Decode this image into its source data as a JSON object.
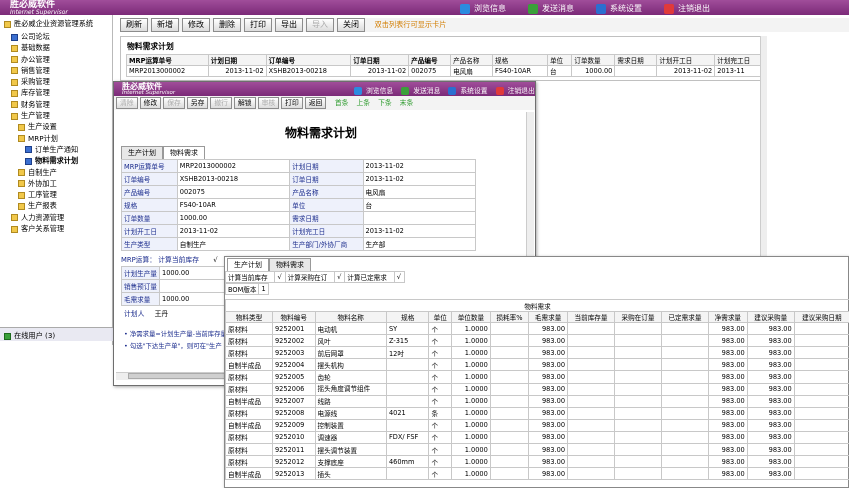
{
  "app": {
    "title": "胜必威企业资源管理系统",
    "logo": "胜必威软件",
    "logo_sub": "Internet Supervisor"
  },
  "topnav": [
    {
      "label": "浏览信息",
      "icon": "browse-icon"
    },
    {
      "label": "发送消息",
      "icon": "send-message-icon"
    },
    {
      "label": "系统设置",
      "icon": "gear-icon"
    },
    {
      "label": "注销退出",
      "icon": "logout-icon"
    }
  ],
  "sidebar": {
    "items": [
      {
        "label": "公司论坛",
        "icon": "forum-icon",
        "indent": 1
      },
      {
        "label": "基础数据",
        "indent": 1
      },
      {
        "label": "办公管理",
        "indent": 1
      },
      {
        "label": "销售管理",
        "indent": 1
      },
      {
        "label": "采购管理",
        "indent": 1
      },
      {
        "label": "库存管理",
        "indent": 1
      },
      {
        "label": "财务管理",
        "indent": 1
      },
      {
        "label": "生产管理",
        "indent": 1
      },
      {
        "label": "生产设置",
        "indent": 2
      },
      {
        "label": "MRP计划",
        "indent": 2
      },
      {
        "label": "订单生产通知",
        "indent": 3,
        "icon": "doc-icon"
      },
      {
        "label": "物料需求计划",
        "indent": 3,
        "icon": "doc-icon",
        "bold": true
      },
      {
        "label": "自制生产",
        "indent": 2
      },
      {
        "label": "外协加工",
        "indent": 2
      },
      {
        "label": "工序管理",
        "indent": 2
      },
      {
        "label": "生产报表",
        "indent": 2
      },
      {
        "label": "人力资源管理",
        "indent": 1
      },
      {
        "label": "客户关系管理",
        "indent": 1
      }
    ],
    "online": "在线用户 (3)"
  },
  "toolbar": {
    "buttons": [
      "刷新",
      "新增",
      "修改",
      "删除",
      "打印",
      "导出",
      "导入",
      "关闭"
    ],
    "disabled": [
      "导入"
    ],
    "hint": "双击列表行可显示卡片"
  },
  "listpanel": {
    "title": "物料需求计划",
    "headers": [
      "MRP运算单号",
      "计划日期",
      "订单编号",
      "订单日期",
      "产品编号",
      "产品名称",
      "规格",
      "单位",
      "订单数量",
      "需求日期",
      "计划开工日",
      "计划完工日"
    ],
    "row": [
      "MRP2013000002",
      "2013-11-02",
      "XSHB2013-00218",
      "2013-11-02",
      "002075",
      "电风扇",
      "FS40-10AR",
      "台",
      "1000.00",
      "",
      "2013-11-02",
      "2013-11"
    ]
  },
  "card": {
    "logo": "胜必威软件",
    "logo_sub": "Internet Supervisor",
    "nav": [
      "浏览信息",
      "发送消息",
      "系统设置",
      "注销退出"
    ],
    "buttons": [
      "清除",
      "修改",
      "保存",
      "另存",
      "撤行",
      "解锁",
      "审核",
      "打印",
      "返回"
    ],
    "disabled": [
      "清除",
      "保存",
      "撤行",
      "审核"
    ],
    "navlinks": [
      "首条",
      "上条",
      "下条",
      "末条"
    ],
    "title": "物料需求计划",
    "tabs": [
      "生产计划",
      "物料需求"
    ],
    "fields": [
      [
        "MRP运算单号",
        "MRP2013000002",
        "计划日期",
        "2013-11-02"
      ],
      [
        "订单编号",
        "XSHB2013-00218",
        "订单日期",
        "2013-11-02"
      ],
      [
        "产品编号",
        "002075",
        "产品名称",
        "电风扇"
      ],
      [
        "规格",
        "FS40-10AR",
        "单位",
        "台"
      ],
      [
        "订单数量",
        "1000.00",
        "需求日期",
        ""
      ],
      [
        "计划开工日",
        "2013-11-02",
        "计划完工日",
        "2013-11-02"
      ],
      [
        "生产类型",
        "自制生产",
        "生产部门/外协厂商",
        "生产部"
      ]
    ],
    "mrp_label": "MRP运算：",
    "mrp_opt": "计算当前库存",
    "mrp_check": "√",
    "small_fields": [
      [
        "计划生产量",
        "1000.00"
      ],
      [
        "销售预订量",
        ""
      ],
      [
        "毛需求量",
        "1000.00"
      ]
    ],
    "planner_label": "计划人",
    "planner": "王丹",
    "notes": [
      "净需求量=计划生产量-当前库存量+销",
      "勾选\"下达生产单\"，则可在\"生产"
    ]
  },
  "detail": {
    "tabs": [
      "生产计划",
      "物料需求"
    ],
    "options": [
      "计算当前库存",
      "√",
      "计算采购在订",
      "√",
      "计算已定需求",
      "√"
    ],
    "bom_label": "BOM版本",
    "bom": "1",
    "section": "物料需求",
    "headers": [
      "物料类型",
      "物料编号",
      "物料名称",
      "规格",
      "单位",
      "单位数量",
      "损耗率%",
      "毛需求量",
      "当前库存量",
      "采购在订量",
      "已定需求量",
      "净需求量",
      "建议采购量",
      "建议采购日期"
    ],
    "rows": [
      [
        "原材料",
        "9252001",
        "电动机",
        "SY",
        "个",
        "1.0000",
        "",
        "983.00",
        "",
        "",
        "",
        "983.00",
        "983.00",
        ""
      ],
      [
        "原材料",
        "9252002",
        "风叶",
        "Z-315",
        "个",
        "1.0000",
        "",
        "983.00",
        "",
        "",
        "",
        "983.00",
        "983.00",
        ""
      ],
      [
        "原材料",
        "9252003",
        "前后网罩",
        "12吋",
        "个",
        "1.0000",
        "",
        "983.00",
        "",
        "",
        "",
        "983.00",
        "983.00",
        ""
      ],
      [
        "自制半成品",
        "9252004",
        "摆头机构",
        "",
        "个",
        "1.0000",
        "",
        "983.00",
        "",
        "",
        "",
        "983.00",
        "983.00",
        ""
      ],
      [
        "原材料",
        "9252005",
        "齿轮",
        "",
        "个",
        "1.0000",
        "",
        "983.00",
        "",
        "",
        "",
        "983.00",
        "983.00",
        ""
      ],
      [
        "原材料",
        "9252006",
        "摇头角度调节组件",
        "",
        "个",
        "1.0000",
        "",
        "983.00",
        "",
        "",
        "",
        "983.00",
        "983.00",
        ""
      ],
      [
        "自制半成品",
        "9252007",
        "线路",
        "",
        "个",
        "1.0000",
        "",
        "983.00",
        "",
        "",
        "",
        "983.00",
        "983.00",
        ""
      ],
      [
        "原材料",
        "9252008",
        "电源线",
        "4021",
        "条",
        "1.0000",
        "",
        "983.00",
        "",
        "",
        "",
        "983.00",
        "983.00",
        ""
      ],
      [
        "自制半成品",
        "9252009",
        "控制装置",
        "",
        "个",
        "1.0000",
        "",
        "983.00",
        "",
        "",
        "",
        "983.00",
        "983.00",
        ""
      ],
      [
        "原材料",
        "9252010",
        "调速器",
        "FDX/ FSF",
        "个",
        "1.0000",
        "",
        "983.00",
        "",
        "",
        "",
        "983.00",
        "983.00",
        ""
      ],
      [
        "原材料",
        "9252011",
        "摆头调节装置",
        "",
        "个",
        "1.0000",
        "",
        "983.00",
        "",
        "",
        "",
        "983.00",
        "983.00",
        ""
      ],
      [
        "原材料",
        "9252012",
        "支撑底座",
        "460mm",
        "个",
        "1.0000",
        "",
        "983.00",
        "",
        "",
        "",
        "983.00",
        "983.00",
        ""
      ],
      [
        "自制半成品",
        "9252013",
        "插头",
        "",
        "个",
        "1.0000",
        "",
        "983.00",
        "",
        "",
        "",
        "983.00",
        "983.00",
        ""
      ]
    ]
  }
}
